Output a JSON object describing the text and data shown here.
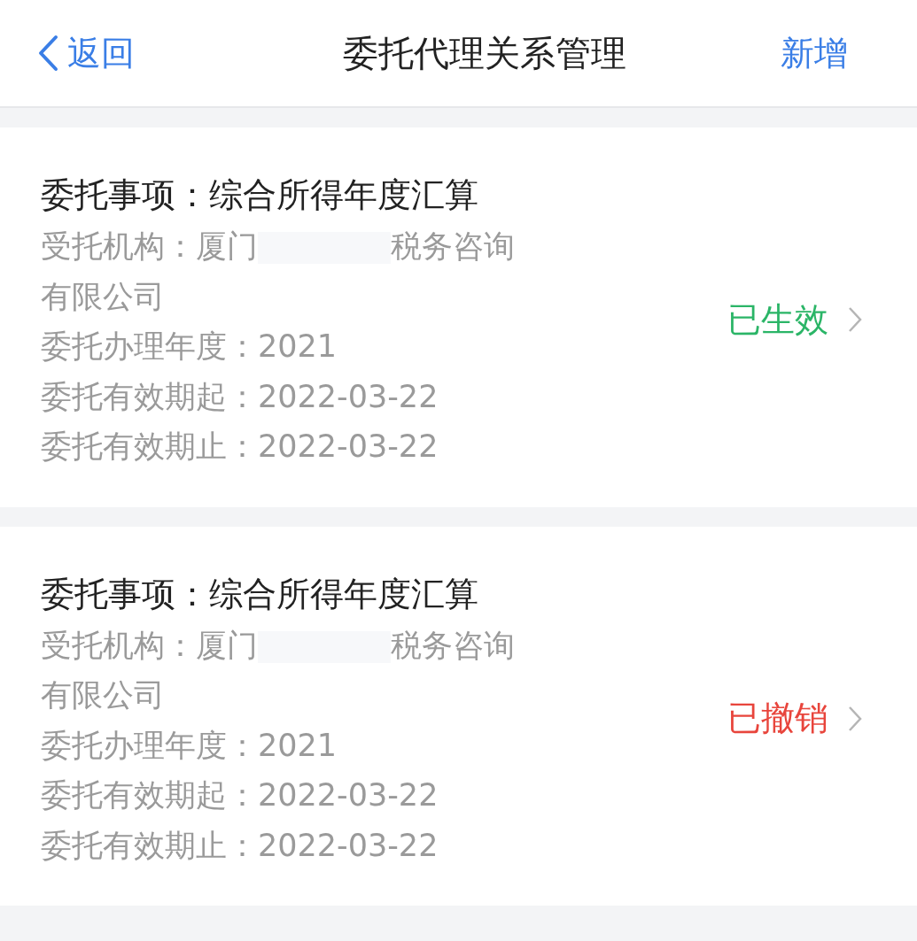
{
  "nav": {
    "back": "返回",
    "title": "委托代理关系管理",
    "action": "新增"
  },
  "records": [
    {
      "title": "委托事项：综合所得年度汇算",
      "org_label": "受托机构：",
      "org_start": "厦门",
      "org_end": [
        "税务咨询",
        "有限公司"
      ],
      "fields": [
        {
          "label": "委托办理年度：",
          "value": "2021"
        },
        {
          "label": "委托有效期起：",
          "value": "2022-03-22"
        },
        {
          "label": "委托有效期止：",
          "value": "2022-03-22"
        }
      ],
      "status": "已生效",
      "color": "#2bb567"
    },
    {
      "title": "委托事项：综合所得年度汇算",
      "org_label": "受托机构：",
      "org_start": "厦门",
      "org_end": [
        "税务咨询",
        "有限公司"
      ],
      "fields": [
        {
          "label": "委托办理年度：",
          "value": "2021"
        },
        {
          "label": "委托有效期起：",
          "value": "2022-03-22"
        },
        {
          "label": "委托有效期止：",
          "value": "2022-03-22"
        }
      ],
      "status": "已撤销",
      "color": "#e8453c"
    }
  ]
}
